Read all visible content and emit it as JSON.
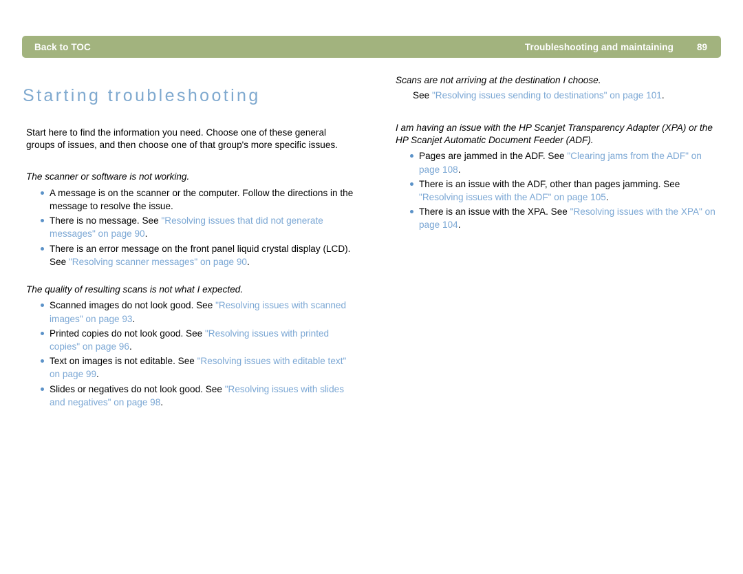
{
  "header": {
    "back_to_toc": "Back to TOC",
    "section_title": "Troubleshooting and maintaining",
    "page_number": "89",
    "bar_color": "#a2b37e"
  },
  "title": "Starting troubleshooting",
  "title_color": "#7fa9cf",
  "link_color": "#7ba7d4",
  "bullet_color": "#5b92c8",
  "intro": "Start here to find the information you need. Choose one of these general groups of issues, and then choose one of that group's more specific issues.",
  "left_column": {
    "sections": [
      {
        "heading": "The scanner or software is not working.",
        "bullets": [
          {
            "pre": "A message is on the scanner or the computer. Follow the directions in the message to resolve the issue.",
            "link": "",
            "post": ""
          },
          {
            "pre": "There is no message. See ",
            "link": "\"Resolving issues that did not generate messages\" on page 90",
            "post": "."
          },
          {
            "pre": "There is an error message on the front panel liquid crystal display (LCD). See ",
            "link": "\"Resolving scanner messages\" on page 90",
            "post": "."
          }
        ]
      },
      {
        "heading": "The quality of resulting scans is not what I expected.",
        "bullets": [
          {
            "pre": "Scanned images do not look good. See ",
            "link": "\"Resolving issues with scanned images\" on page 93",
            "post": "."
          },
          {
            "pre": "Printed copies do not look good. See ",
            "link": "\"Resolving issues with printed copies\" on page 96",
            "post": "."
          },
          {
            "pre": "Text on images is not editable. See ",
            "link": "\"Resolving issues with editable text\" on page 99",
            "post": "."
          },
          {
            "pre": "Slides or negatives do not look good. See ",
            "link": "\"Resolving issues with slides and negatives\" on page 98",
            "post": "."
          }
        ]
      }
    ]
  },
  "right_column": {
    "sections": [
      {
        "heading": "Scans are not arriving at the destination I choose.",
        "see_line": {
          "pre": "See ",
          "link": "\"Resolving issues sending to destinations\" on page 101",
          "post": "."
        },
        "bullets": []
      },
      {
        "heading": "I am having an issue with the HP Scanjet Transparency Adapter (XPA) or the HP Scanjet Automatic Document Feeder (ADF).",
        "bullets": [
          {
            "pre": "Pages are jammed in the ADF. See ",
            "link": "\"Clearing jams from the ADF\" on page 108",
            "post": "."
          },
          {
            "pre": "There is an issue with the ADF, other than pages jamming. See ",
            "link": "\"Resolving issues with the ADF\" on page 105",
            "post": "."
          },
          {
            "pre": "There is an issue with the XPA. See ",
            "link": "\"Resolving issues with the XPA\" on page 104",
            "post": "."
          }
        ]
      }
    ]
  }
}
